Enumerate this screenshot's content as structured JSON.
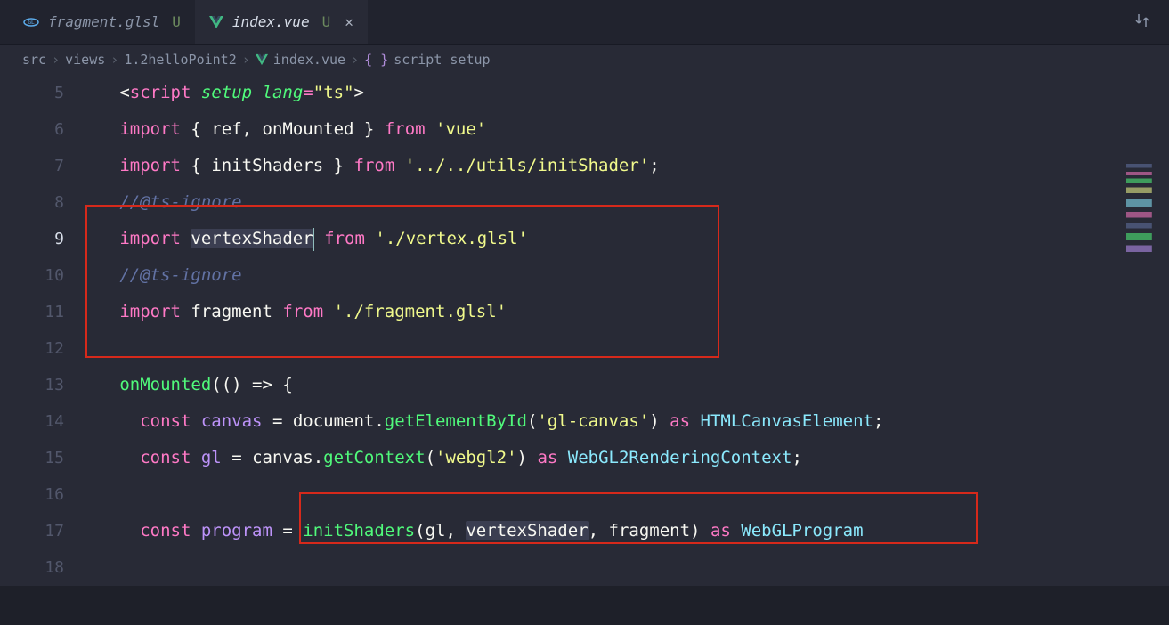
{
  "tabs": [
    {
      "icon": "glsl",
      "label": "fragment.glsl",
      "status": "U",
      "active": false
    },
    {
      "icon": "vue",
      "label": "index.vue",
      "status": "U",
      "active": true,
      "closable": true
    }
  ],
  "breadcrumb": {
    "parts": [
      "src",
      "views",
      "1.2helloPoint2"
    ],
    "file": "index.vue",
    "symbol": "script setup"
  },
  "lines": {
    "l5": {
      "num": "5",
      "tokens": {
        "lt": "<",
        "tag": "script",
        "a1": "setup",
        "a2": "lang",
        "eq": "=",
        "val": "\"ts\"",
        "gt": ">"
      }
    },
    "l6": {
      "num": "6",
      "tokens": {
        "kw1": "import",
        "lb": "{ ",
        "v1": "ref",
        "c": ", ",
        "v2": "onMounted",
        "rb": " }",
        "kw2": "from",
        "str": "'vue'"
      }
    },
    "l7": {
      "num": "7",
      "breakpoint": true,
      "tokens": {
        "kw1": "import",
        "lb": "{ ",
        "v1": "initShaders",
        "rb": " }",
        "kw2": "from",
        "str": "'../../utils/initShader'",
        "semi": ";"
      }
    },
    "l8": {
      "num": "8",
      "lightbulb": true,
      "tokens": {
        "comment": "//@ts-ignore"
      }
    },
    "l9": {
      "num": "9",
      "current": true,
      "tokens": {
        "kw1": "import",
        "v1": "vertexShader",
        "kw2": "from",
        "str": "'./vertex.glsl'"
      }
    },
    "l10": {
      "num": "10",
      "tokens": {
        "comment": "//@ts-ignore"
      }
    },
    "l11": {
      "num": "11",
      "tokens": {
        "kw1": "import",
        "v1": "fragment",
        "kw2": "from",
        "str": "'./fragment.glsl'"
      }
    },
    "l12": {
      "num": "12"
    },
    "l13": {
      "num": "13",
      "tokens": {
        "fn": "onMounted",
        "p": "(() => {"
      }
    },
    "l14": {
      "num": "14",
      "tokens": {
        "kw": "const",
        "v": "canvas",
        "eq": " = ",
        "o": "document",
        "d": ".",
        "m": "getElementById",
        "lp": "(",
        "s": "'gl-canvas'",
        "rp": ")",
        "as": "as",
        "t": "HTMLCanvasElement",
        "semi": ";"
      }
    },
    "l15": {
      "num": "15",
      "tokens": {
        "kw": "const",
        "v": "gl",
        "eq": " = ",
        "o": "canvas",
        "d": ".",
        "m": "getContext",
        "lp": "(",
        "s": "'webgl2'",
        "rp": ")",
        "as": "as",
        "t": "WebGL2RenderingContext",
        "semi": ";"
      }
    },
    "l16": {
      "num": "16"
    },
    "l17": {
      "num": "17",
      "tokens": {
        "kw": "const",
        "v": "program",
        "eq": " = ",
        "fn": "initShaders",
        "lp": "(",
        "a1": "gl",
        "c1": ", ",
        "a2": "vertexShader",
        "c2": ", ",
        "a3": "fragment",
        "rp": ")",
        "as": "as",
        "t": "WebGLProgram"
      }
    },
    "l18": {
      "num": "18"
    }
  }
}
